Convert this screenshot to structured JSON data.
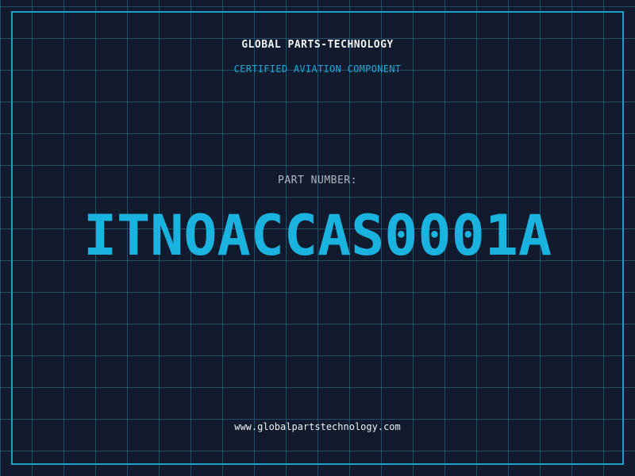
{
  "header": {
    "company": "GLOBAL PARTS-TECHNOLOGY",
    "subtitle": "CERTIFIED AVIATION COMPONENT"
  },
  "part": {
    "label": "PART NUMBER:",
    "number": "ITNOACCAS0001A"
  },
  "footer": {
    "website": "www.globalpartstechnology.com"
  },
  "colors": {
    "background": "#121a2d",
    "grid": "#285f7d",
    "accent": "#1ab2df",
    "text": "#f1f3f5",
    "muted": "#aeb6c2"
  }
}
